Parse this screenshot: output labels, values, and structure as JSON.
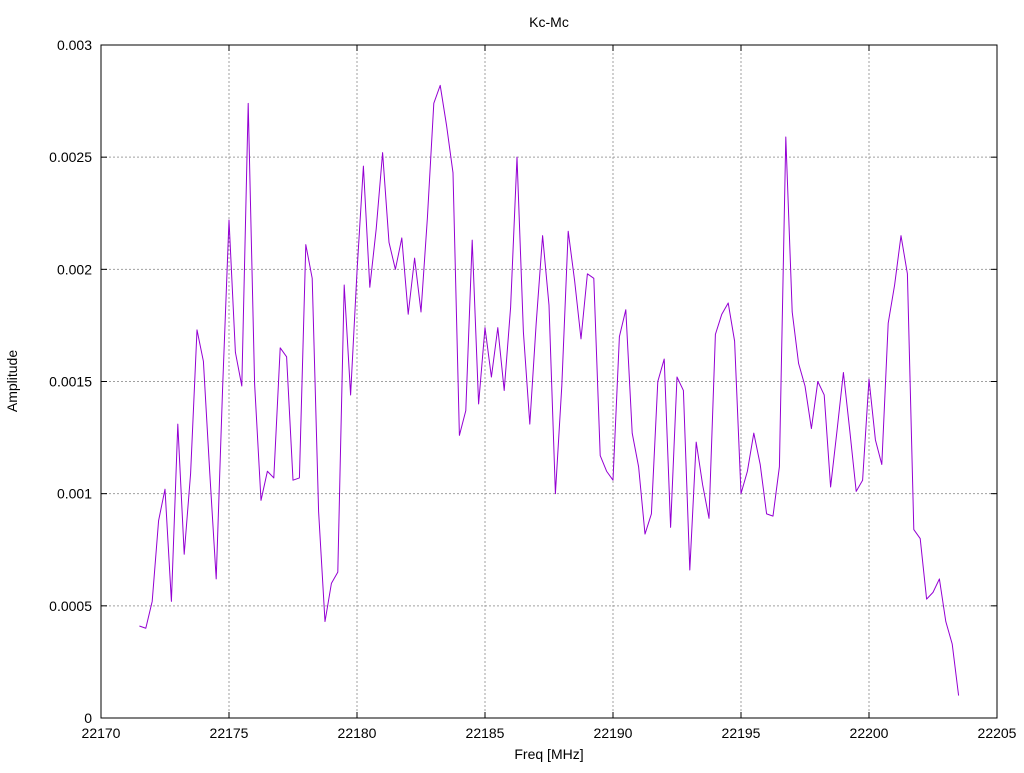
{
  "chart_data": {
    "type": "line",
    "title": "Kc-Mc",
    "xlabel": "Freq [MHz]",
    "ylabel": "Amplitude",
    "xlim": [
      22170,
      22205
    ],
    "ylim": [
      0,
      0.003
    ],
    "x_ticks": [
      22170,
      22175,
      22180,
      22185,
      22190,
      22195,
      22200,
      22205
    ],
    "x_tick_labels": [
      "22170",
      "22175",
      "22180",
      "22185",
      "22190",
      "22195",
      "22200",
      "22205"
    ],
    "y_ticks": [
      0,
      0.0005,
      0.001,
      0.0015,
      0.002,
      0.0025,
      0.003
    ],
    "y_tick_labels": [
      "0",
      "0.0005",
      "0.001",
      "0.0015",
      "0.002",
      "0.0025",
      "0.003"
    ],
    "grid": true,
    "colors": {
      "series": "#9400d3",
      "grid": "#a0a0a0",
      "axis": "#000000"
    },
    "series": [
      {
        "x": [
          22171.5,
          22171.75,
          22172.0,
          22172.25,
          22172.5,
          22172.75,
          22173.0,
          22173.25,
          22173.5,
          22173.75,
          22174.0,
          22174.25,
          22174.5,
          22174.75,
          22175.0,
          22175.25,
          22175.5,
          22175.75,
          22176.0,
          22176.25,
          22176.5,
          22176.75,
          22177.0,
          22177.25,
          22177.5,
          22177.75,
          22178.0,
          22178.25,
          22178.5,
          22178.75,
          22179.0,
          22179.25,
          22179.5,
          22179.75,
          22180.0,
          22180.25,
          22180.5,
          22180.75,
          22181.0,
          22181.25,
          22181.5,
          22181.75,
          22182.0,
          22182.25,
          22182.5,
          22182.75,
          22183.0,
          22183.25,
          22183.5,
          22183.75,
          22184.0,
          22184.25,
          22184.5,
          22184.75,
          22185.0,
          22185.25,
          22185.5,
          22185.75,
          22186.0,
          22186.25,
          22186.5,
          22186.75,
          22187.0,
          22187.25,
          22187.5,
          22187.75,
          22188.0,
          22188.25,
          22188.5,
          22188.75,
          22189.0,
          22189.25,
          22189.5,
          22189.75,
          22190.0,
          22190.25,
          22190.5,
          22190.75,
          22191.0,
          22191.25,
          22191.5,
          22191.75,
          22192.0,
          22192.25,
          22192.5,
          22192.75,
          22193.0,
          22193.25,
          22193.5,
          22193.75,
          22194.0,
          22194.25,
          22194.5,
          22194.75,
          22195.0,
          22195.25,
          22195.5,
          22195.75,
          22196.0,
          22196.25,
          22196.5,
          22196.75,
          22197.0,
          22197.25,
          22197.5,
          22197.75,
          22198.0,
          22198.25,
          22198.5,
          22198.75,
          22199.0,
          22199.25,
          22199.5,
          22199.75,
          22200.0,
          22200.25,
          22200.5,
          22200.75,
          22201.0,
          22201.25,
          22201.5,
          22201.75,
          22202.0,
          22202.25,
          22202.5,
          22202.75,
          22203.0,
          22203.25,
          22203.5
        ],
        "y": [
          0.00041,
          0.0004,
          0.00052,
          0.00088,
          0.00102,
          0.00052,
          0.00131,
          0.00073,
          0.00109,
          0.00173,
          0.00159,
          0.00109,
          0.00062,
          0.00147,
          0.00222,
          0.00163,
          0.00148,
          0.00274,
          0.00149,
          0.00097,
          0.0011,
          0.00107,
          0.00165,
          0.00161,
          0.00106,
          0.00107,
          0.00211,
          0.00196,
          0.00092,
          0.00043,
          0.0006,
          0.00065,
          0.00193,
          0.00144,
          0.00199,
          0.00246,
          0.00192,
          0.00218,
          0.00252,
          0.00212,
          0.002,
          0.00214,
          0.0018,
          0.00205,
          0.00181,
          0.00223,
          0.00274,
          0.00282,
          0.00264,
          0.00243,
          0.00126,
          0.00137,
          0.00213,
          0.0014,
          0.00174,
          0.00152,
          0.00174,
          0.00146,
          0.00183,
          0.0025,
          0.00172,
          0.00131,
          0.00176,
          0.00215,
          0.00184,
          0.001,
          0.00148,
          0.00217,
          0.00195,
          0.00169,
          0.00198,
          0.00196,
          0.00117,
          0.0011,
          0.00106,
          0.0017,
          0.00182,
          0.00127,
          0.00112,
          0.00082,
          0.00091,
          0.0015,
          0.0016,
          0.00085,
          0.00152,
          0.00146,
          0.00066,
          0.00123,
          0.00104,
          0.00089,
          0.00171,
          0.0018,
          0.00185,
          0.00168,
          0.001,
          0.0011,
          0.00127,
          0.00113,
          0.00091,
          0.0009,
          0.00112,
          0.00259,
          0.00181,
          0.00158,
          0.00148,
          0.00129,
          0.0015,
          0.00144,
          0.00103,
          0.00128,
          0.00154,
          0.00128,
          0.00101,
          0.00106,
          0.00151,
          0.00124,
          0.00113,
          0.00176,
          0.00193,
          0.00215,
          0.00198,
          0.00084,
          0.0008,
          0.00053,
          0.00056,
          0.00062,
          0.00043,
          0.00033,
          0.0001
        ]
      }
    ]
  }
}
